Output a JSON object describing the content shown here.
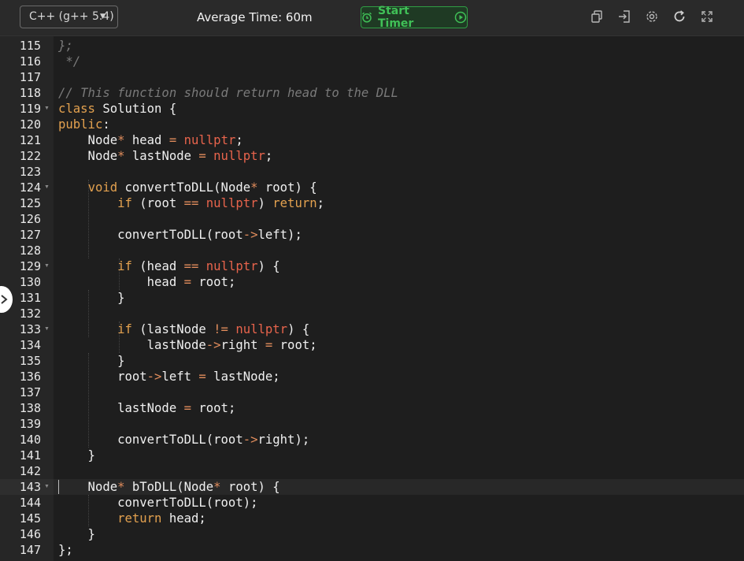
{
  "toolbar": {
    "language": "C++ (g++ 5.4)",
    "average_time": "Average Time: 60m",
    "start_timer": "Start Timer",
    "icons": [
      "copy-icon",
      "sign-in-icon",
      "gear-icon",
      "refresh-icon",
      "fullscreen-icon"
    ]
  },
  "colors": {
    "accent_green": "#40c057",
    "keyword": "#e3a14f",
    "literal": "#e8644c",
    "comment": "#7a7a7a",
    "background": "#1e1e1e"
  },
  "editor": {
    "active_line": 143,
    "lines": [
      {
        "n": "115",
        "tokens": [
          {
            "c": "cm",
            "t": "};"
          }
        ]
      },
      {
        "n": "116",
        "tokens": [
          {
            "c": "cm",
            "t": " */"
          }
        ]
      },
      {
        "n": "117",
        "tokens": []
      },
      {
        "n": "118",
        "tokens": [
          {
            "c": "cm",
            "t": "// This function should return head to the DLL"
          }
        ]
      },
      {
        "n": "119",
        "fold": true,
        "tokens": [
          {
            "c": "kw",
            "t": "class"
          },
          {
            "c": "tx",
            "t": " Solution {"
          }
        ]
      },
      {
        "n": "120",
        "tokens": [
          {
            "c": "kw",
            "t": "public"
          },
          {
            "c": "tx",
            "t": ":"
          }
        ]
      },
      {
        "n": "121",
        "tokens": [
          {
            "c": "tx",
            "t": "    Node"
          },
          {
            "c": "op",
            "t": "*"
          },
          {
            "c": "tx",
            "t": " head "
          },
          {
            "c": "op",
            "t": "="
          },
          {
            "c": "tx",
            "t": " "
          },
          {
            "c": "num",
            "t": "nullptr"
          },
          {
            "c": "tx",
            "t": ";"
          }
        ]
      },
      {
        "n": "122",
        "tokens": [
          {
            "c": "tx",
            "t": "    Node"
          },
          {
            "c": "op",
            "t": "*"
          },
          {
            "c": "tx",
            "t": " lastNode "
          },
          {
            "c": "op",
            "t": "="
          },
          {
            "c": "tx",
            "t": " "
          },
          {
            "c": "num",
            "t": "nullptr"
          },
          {
            "c": "tx",
            "t": ";"
          }
        ]
      },
      {
        "n": "123",
        "tokens": []
      },
      {
        "n": "124",
        "fold": true,
        "tokens": [
          {
            "c": "tx",
            "t": "    "
          },
          {
            "c": "kw",
            "t": "void"
          },
          {
            "c": "tx",
            "t": " convertToDLL(Node"
          },
          {
            "c": "op",
            "t": "*"
          },
          {
            "c": "tx",
            "t": " root) {"
          }
        ]
      },
      {
        "n": "125",
        "tokens": [
          {
            "c": "tx",
            "t": "        "
          },
          {
            "c": "kw",
            "t": "if"
          },
          {
            "c": "tx",
            "t": " (root "
          },
          {
            "c": "op",
            "t": "=="
          },
          {
            "c": "tx",
            "t": " "
          },
          {
            "c": "num",
            "t": "nullptr"
          },
          {
            "c": "tx",
            "t": ") "
          },
          {
            "c": "kw",
            "t": "return"
          },
          {
            "c": "tx",
            "t": ";"
          }
        ]
      },
      {
        "n": "126",
        "tokens": []
      },
      {
        "n": "127",
        "tokens": [
          {
            "c": "tx",
            "t": "        convertToDLL(root"
          },
          {
            "c": "op",
            "t": "->"
          },
          {
            "c": "tx",
            "t": "left);"
          }
        ]
      },
      {
        "n": "128",
        "tokens": []
      },
      {
        "n": "129",
        "fold": true,
        "tokens": [
          {
            "c": "tx",
            "t": "        "
          },
          {
            "c": "kw",
            "t": "if"
          },
          {
            "c": "tx",
            "t": " (head "
          },
          {
            "c": "op",
            "t": "=="
          },
          {
            "c": "tx",
            "t": " "
          },
          {
            "c": "num",
            "t": "nullptr"
          },
          {
            "c": "tx",
            "t": ") {"
          }
        ]
      },
      {
        "n": "130",
        "tokens": [
          {
            "c": "tx",
            "t": "            head "
          },
          {
            "c": "op",
            "t": "="
          },
          {
            "c": "tx",
            "t": " root;"
          }
        ]
      },
      {
        "n": "131",
        "tokens": [
          {
            "c": "tx",
            "t": "        }"
          }
        ]
      },
      {
        "n": "132",
        "tokens": []
      },
      {
        "n": "133",
        "fold": true,
        "tokens": [
          {
            "c": "tx",
            "t": "        "
          },
          {
            "c": "kw",
            "t": "if"
          },
          {
            "c": "tx",
            "t": " (lastNode "
          },
          {
            "c": "op",
            "t": "!="
          },
          {
            "c": "tx",
            "t": " "
          },
          {
            "c": "num",
            "t": "nullptr"
          },
          {
            "c": "tx",
            "t": ") {"
          }
        ]
      },
      {
        "n": "134",
        "tokens": [
          {
            "c": "tx",
            "t": "            lastNode"
          },
          {
            "c": "op",
            "t": "->"
          },
          {
            "c": "tx",
            "t": "right "
          },
          {
            "c": "op",
            "t": "="
          },
          {
            "c": "tx",
            "t": " root;"
          }
        ]
      },
      {
        "n": "135",
        "tokens": [
          {
            "c": "tx",
            "t": "        }"
          }
        ]
      },
      {
        "n": "136",
        "tokens": [
          {
            "c": "tx",
            "t": "        root"
          },
          {
            "c": "op",
            "t": "->"
          },
          {
            "c": "tx",
            "t": "left "
          },
          {
            "c": "op",
            "t": "="
          },
          {
            "c": "tx",
            "t": " lastNode;"
          }
        ]
      },
      {
        "n": "137",
        "tokens": []
      },
      {
        "n": "138",
        "tokens": [
          {
            "c": "tx",
            "t": "        lastNode "
          },
          {
            "c": "op",
            "t": "="
          },
          {
            "c": "tx",
            "t": " root;"
          }
        ]
      },
      {
        "n": "139",
        "tokens": []
      },
      {
        "n": "140",
        "tokens": [
          {
            "c": "tx",
            "t": "        convertToDLL(root"
          },
          {
            "c": "op",
            "t": "->"
          },
          {
            "c": "tx",
            "t": "right);"
          }
        ]
      },
      {
        "n": "141",
        "tokens": [
          {
            "c": "tx",
            "t": "    }"
          }
        ]
      },
      {
        "n": "142",
        "tokens": []
      },
      {
        "n": "143",
        "fold": true,
        "tokens": [
          {
            "c": "tx",
            "t": "    Node"
          },
          {
            "c": "op",
            "t": "*"
          },
          {
            "c": "tx",
            "t": " bToDLL(Node"
          },
          {
            "c": "op",
            "t": "*"
          },
          {
            "c": "tx",
            "t": " root) {"
          }
        ]
      },
      {
        "n": "144",
        "tokens": [
          {
            "c": "tx",
            "t": "        convertToDLL(root);"
          }
        ]
      },
      {
        "n": "145",
        "tokens": [
          {
            "c": "tx",
            "t": "        "
          },
          {
            "c": "kw",
            "t": "return"
          },
          {
            "c": "tx",
            "t": " head;"
          }
        ]
      },
      {
        "n": "146",
        "tokens": [
          {
            "c": "tx",
            "t": "    }"
          }
        ]
      },
      {
        "n": "147",
        "tokens": [
          {
            "c": "tx",
            "t": "};"
          }
        ]
      }
    ]
  }
}
